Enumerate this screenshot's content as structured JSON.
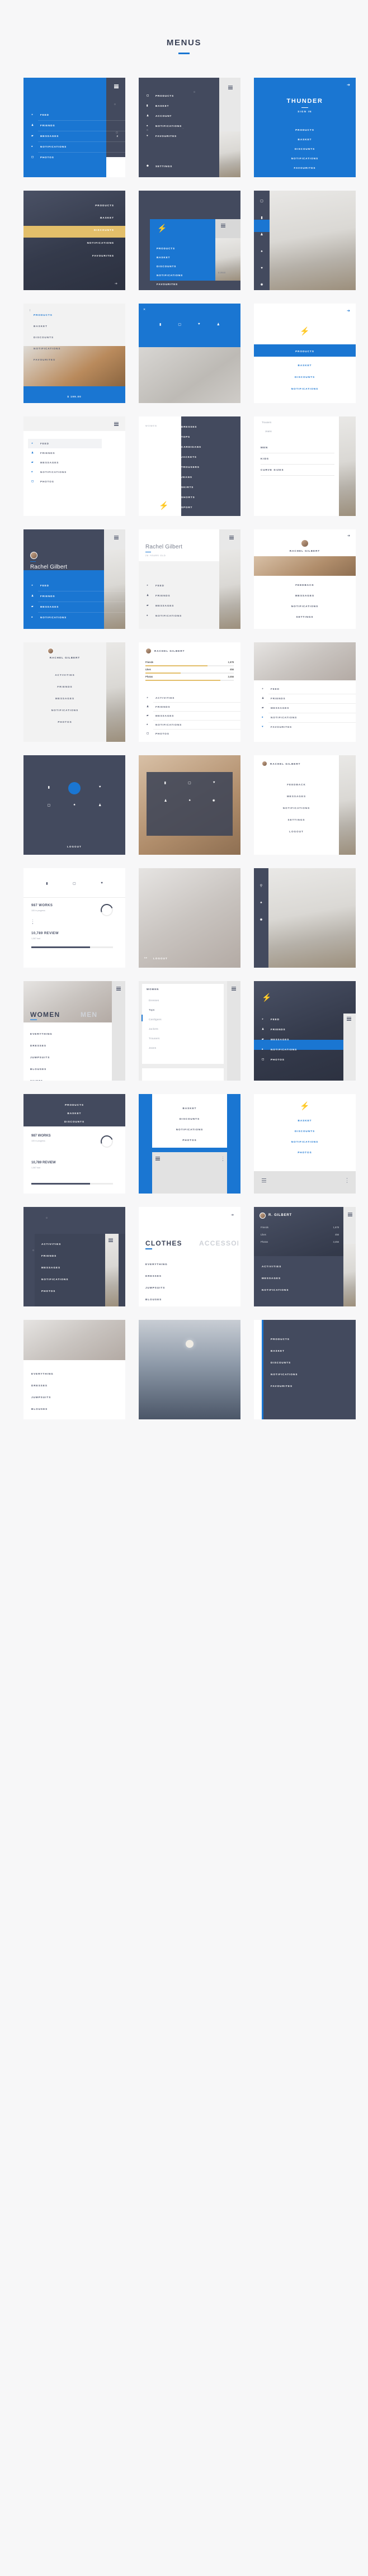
{
  "header": {
    "title": "MENUS"
  },
  "brand": {
    "name": "THUNDER",
    "short": "R. GILBERT",
    "signin": "SIGN IN",
    "logo_icon": "bolt-icon"
  },
  "colors": {
    "blue": "#1a76d2",
    "dark": "#434a5e",
    "gold": "#e3bf6a",
    "light": "#f0f0f0",
    "white": "#ffffff"
  },
  "user": {
    "full_name": "Rachel Gilbert",
    "short_name": "RACHEL GILBERT",
    "initial_name": "R. GILBERT",
    "age": "28 YEARS OLD",
    "stats": [
      {
        "label": "Friends",
        "value": "1,678"
      },
      {
        "label": "Likes",
        "value": "456"
      },
      {
        "label": "Photos",
        "value": "3,456"
      }
    ]
  },
  "social_menu": [
    {
      "label": "FEED",
      "icon": "clock-icon",
      "badge": ""
    },
    {
      "label": "FRIENDS",
      "icon": "user-icon",
      "badge": ""
    },
    {
      "label": "MESSAGES",
      "icon": "message-icon",
      "badge": "2"
    },
    {
      "label": "NOTIFICATIONS",
      "icon": "bell-icon",
      "badge": ""
    },
    {
      "label": "PHOTOS",
      "icon": "photo-icon",
      "badge": ""
    },
    {
      "label": "SETTINGS",
      "icon": "gear-icon",
      "badge": ""
    }
  ],
  "shop_menu": [
    {
      "label": "PRODUCTS",
      "icon": "photo-icon"
    },
    {
      "label": "BASKET",
      "icon": "bag-icon"
    },
    {
      "label": "ACCOUNT",
      "icon": "user-icon"
    },
    {
      "label": "NOTIFICATIONS",
      "icon": "bell-icon"
    },
    {
      "label": "FAVOURITES",
      "icon": "heart-icon"
    }
  ],
  "shop_menu_alt": [
    "PRODUCTS",
    "BASKET",
    "DISCOUNTS",
    "NOTIFICATIONS",
    "FAVOURITES"
  ],
  "profile_menu": [
    "ACTIVITIES",
    "FRIENDS",
    "MESSAGES",
    "NOTIFICATIONS",
    "PHOTOS",
    "SETTINGS"
  ],
  "profile_menu_b": [
    "FEEDBACK",
    "MESSAGES",
    "NOTIFICATIONS",
    "SETTINGS",
    "LOGOUT"
  ],
  "category_menu": [
    "Dresses",
    "Tops",
    "Cardigans",
    "Jackets",
    "Trousers",
    "Jeans"
  ],
  "category_menu_caps": [
    "DRESSES",
    "TOPS",
    "CARDIGANS",
    "JACKETS",
    "TROUSERS",
    "JEANS",
    "SKIRTS",
    "SHORTS",
    "SPORT"
  ],
  "gender_menu": [
    "WOMEN",
    "MEN",
    "KIDS",
    "CURVE SIZES"
  ],
  "women_items": [
    "EVERYTHING",
    "DRESSES",
    "JUMPSUITS",
    "BLOUSES",
    "SKIRTS",
    "TROUSERS"
  ],
  "tabs": {
    "women": "WOMEN",
    "men": "MEN",
    "clothes": "CLOTHES",
    "accessories": "ACCESSORIES"
  },
  "stats_panel": {
    "works_value": "987 WORKS",
    "works_sub": "105 in progress",
    "review_value": "10,789 REVIEW",
    "review_sub": "1,567 bad",
    "progress_percent": 72
  },
  "actions": {
    "logout": "LOGOUT",
    "settings": "SETTINGS",
    "price": "$ 199.00"
  },
  "icons": {
    "burger": "hamburger-menu-icon",
    "close": "close-icon",
    "arrow_right": "arrow-right-icon",
    "arrow_up": "arrow-up-icon",
    "lock": "lock-icon",
    "heart": "heart-icon",
    "user": "user-icon",
    "photo": "photo-icon",
    "pin": "pin-icon",
    "bell": "bell-icon",
    "gear": "gear-icon",
    "dots": "more-vertical-icon"
  }
}
